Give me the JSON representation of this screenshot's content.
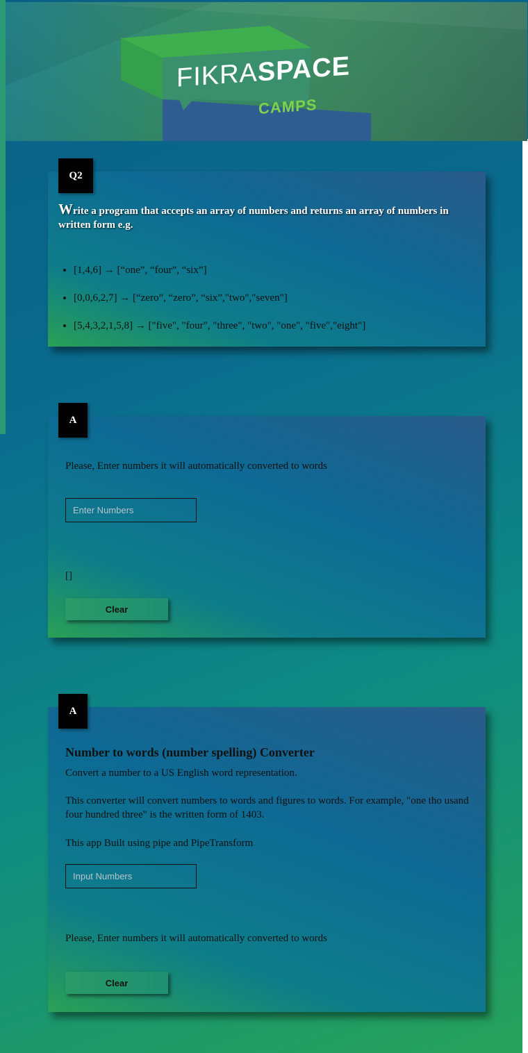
{
  "banner": {
    "logo_light": "FIKRA",
    "logo_bold": "SPACE",
    "logo_sub": "CAMPS"
  },
  "question": {
    "tag": "Q2",
    "title_cap": "W",
    "title_rest": "rite a program that accepts an array of numbers and returns an array of numbers in written form e.g.",
    "examples": [
      "[1,4,6] → [“one”, “four”, “six”]",
      "[0,0,6,2,7] → [“zero”, “zero”, “six”,\"two\",\"seven\"]",
      "[5,4,3,2,1,5,8] → [\"five\", \"four\", \"three\", \"two\", \"one\", \"five\",\"eight\"]"
    ]
  },
  "answer1": {
    "tag": "A",
    "instruction": "Please, Enter numbers it will automatically converted to words",
    "input_placeholder": "Enter Numbers",
    "output": "[]",
    "clear_label": "Clear"
  },
  "answer2": {
    "tag": "A",
    "heading": "Number to words (number spelling) Converter",
    "desc1": "Convert a number to a US English word representation.",
    "desc2": "This converter will convert numbers to words and figures to words. For example, \"one tho usand four hundred three\" is the written form of 1403.",
    "desc3": "This app Built using pipe and PipeTransform",
    "input_placeholder": "Input Numbers",
    "instruction": "Please, Enter numbers it will automatically converted to words",
    "clear_label": "Clear"
  }
}
